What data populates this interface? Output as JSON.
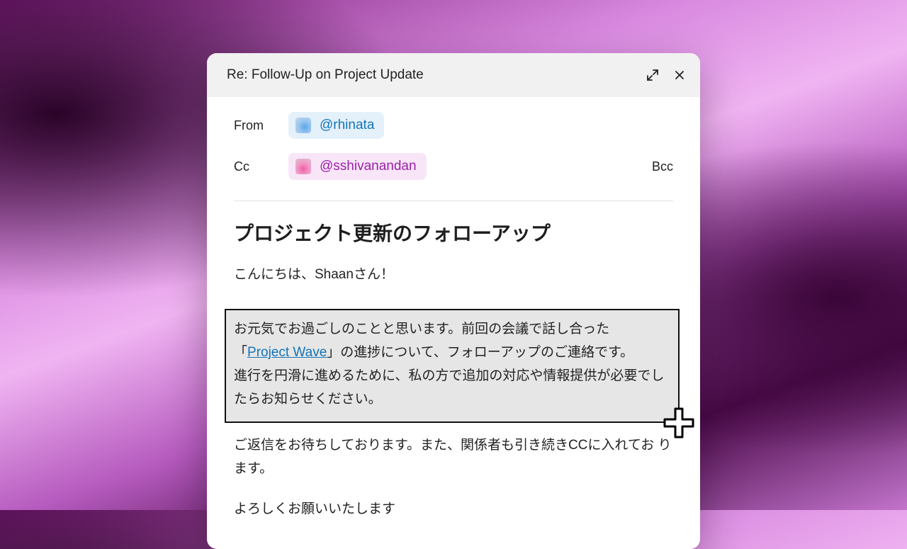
{
  "window": {
    "title": "Re: Follow-Up on Project Update"
  },
  "header": {
    "from_label": "From",
    "from_handle": "@rhinata",
    "cc_label": "Cc",
    "cc_handle": "@sshivanandan",
    "bcc_label": "Bcc"
  },
  "body": {
    "heading": "プロジェクト更新のフォローアップ",
    "greeting": "こんにちは、Shaanさん！",
    "para1_line1": "お元気でお過ごしのことと思います。前回の会議で話し合った",
    "para1_quote_open": "「",
    "para1_link": "Project Wave",
    "para1_quote_rest": "」の進捗について、フォローアップのご連絡です。",
    "para1_line3": "進行を円滑に進めるために、私の方で追加の対応や情報提供が必要でし",
    "para1_line4": "たらお知らせください。",
    "para2": "ご返信をお待ちしております。また、関係者も引き続きCCに入れてお ります。",
    "para3": "よろしくお願いいたします"
  },
  "colors": {
    "link": "#1474b8",
    "from_chip_bg": "#e4f1fb",
    "cc_chip_bg": "#f8e6f8",
    "cc_text": "#9b1fa8",
    "selection_bg": "#e6e6e6"
  },
  "icons": [
    "expand-icon",
    "close-icon",
    "crosshair-cursor-icon"
  ]
}
